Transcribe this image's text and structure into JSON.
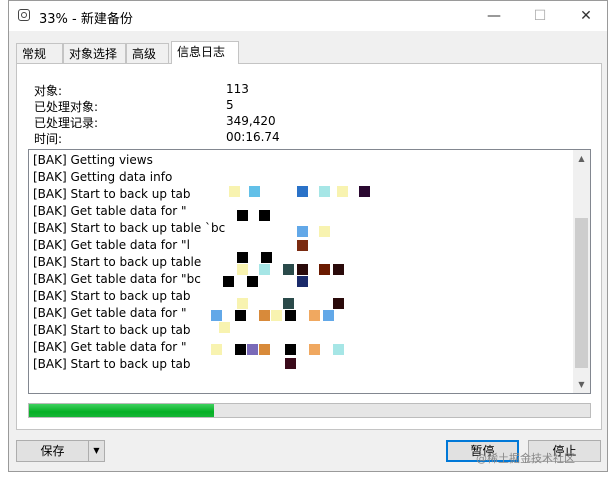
{
  "window": {
    "title": "33% - 新建备份",
    "minimize_glyph": "—",
    "maximize_glyph": "☐",
    "close_glyph": "✕"
  },
  "tabs": [
    {
      "label": "常规"
    },
    {
      "label": "对象选择"
    },
    {
      "label": "高级"
    },
    {
      "label": "信息日志",
      "active": true
    }
  ],
  "stats": [
    {
      "label": "对象:",
      "value": "113"
    },
    {
      "label": "已处理对象:",
      "value": "5"
    },
    {
      "label": "已处理记录:",
      "value": "349,420"
    },
    {
      "label": "时间:",
      "value": "00:16.74"
    }
  ],
  "log": [
    "[BAK] Getting views",
    "[BAK] Getting data info",
    "[BAK] Start to back up tab",
    "[BAK] Get table data for \"",
    "[BAK] Start to back up table `bc",
    "[BAK] Get table data for \"l",
    "[BAK] Start to back up table",
    "[BAK] Get table data for \"bc",
    "[BAK] Start to back up tab",
    "[BAK] Get table data for \"",
    "[BAK] Start to back up tab",
    "[BAK] Get table data for \"",
    "[BAK] Start to back up tab"
  ],
  "scroll": {
    "up_glyph": "▲",
    "down_glyph": "▼"
  },
  "progress": {
    "fraction": 0.33,
    "fill_color": "#06b025"
  },
  "buttons": {
    "save": "保存",
    "save_dropdown": "▼",
    "pause": "暂停",
    "stop": "停止"
  },
  "watermark": "@稀土掘金技术社区",
  "colors": {
    "accent": "#0078d7"
  }
}
